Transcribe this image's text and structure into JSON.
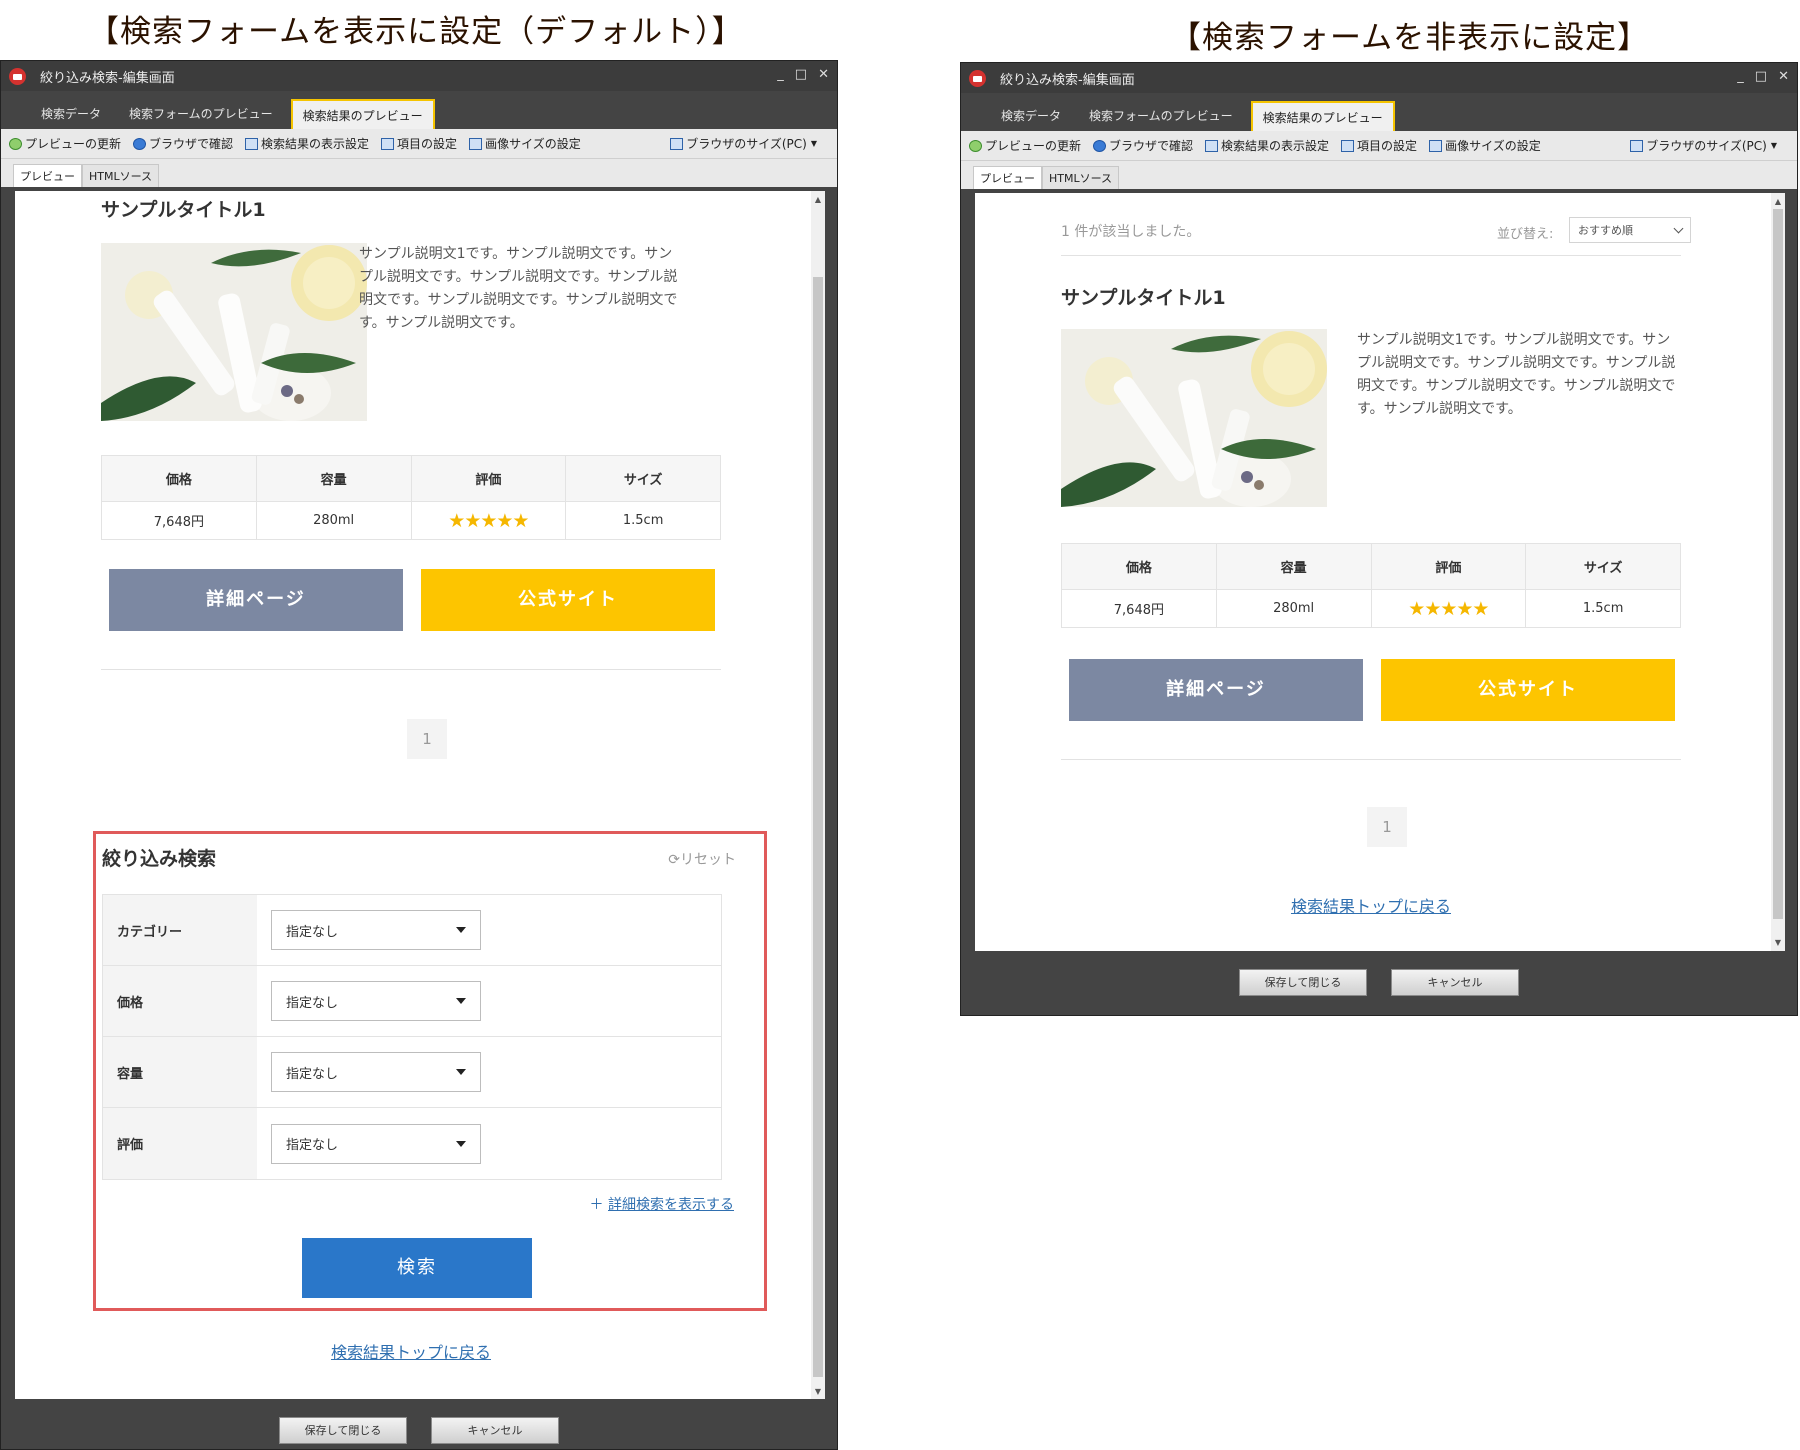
{
  "headings": {
    "left": "【検索フォームを表示に設定（デフォルト）】",
    "right": "【検索フォームを非表示に設定】"
  },
  "window": {
    "title": "絞り込み検索-編集画面",
    "controls": [
      "_",
      "□",
      "✕"
    ],
    "tabs": [
      "検索データ",
      "検索フォームのプレビュー",
      "検索結果のプレビュー"
    ],
    "toolbar": {
      "refresh": "プレビューの更新",
      "browser_check": "ブラウザで確認",
      "result_display": "検索結果の表示設定",
      "item_settings": "項目の設定",
      "image_size": "画像サイズの設定",
      "browser_size": "ブラウザのサイズ(PC)"
    },
    "subtabs": [
      "プレビュー",
      "HTMLソース"
    ],
    "footer": {
      "save": "保存して閉じる",
      "cancel": "キャンセル"
    }
  },
  "result": {
    "count_text": "1 件が該当しました。",
    "sort_label": "並び替え:",
    "sort_value": "おすすめ順",
    "item": {
      "title": "サンプルタイトル1",
      "description": "サンプル説明文1です。サンプル説明文です。サンプル説明文です。サンプル説明文です。サンプル説明文です。サンプル説明文です。サンプル説明文です。サンプル説明文です。",
      "specs": {
        "headers": [
          "価格",
          "容量",
          "評価",
          "サイズ"
        ],
        "values": [
          "7,648円",
          "280ml",
          "★★★★★",
          "1.5cm"
        ],
        "rating": 5
      },
      "detail_button": "詳細ページ",
      "official_button": "公式サイト"
    },
    "page": "1",
    "top_link": "検索結果トップに戻る"
  },
  "search_form": {
    "title": "絞り込み検索",
    "reset": "リセット",
    "rows": [
      {
        "label": "カテゴリー",
        "value": "指定なし"
      },
      {
        "label": "価格",
        "value": "指定なし"
      },
      {
        "label": "容量",
        "value": "指定なし"
      },
      {
        "label": "評価",
        "value": "指定なし"
      }
    ],
    "advanced": "詳細検索を表示する",
    "submit": "検索"
  },
  "colors": {
    "highlight_border": "#e05a5a",
    "detail_button": "#7c88a2",
    "official_button": "#fdc500",
    "search_button": "#2a77c9",
    "active_tab": "#f5c400"
  }
}
